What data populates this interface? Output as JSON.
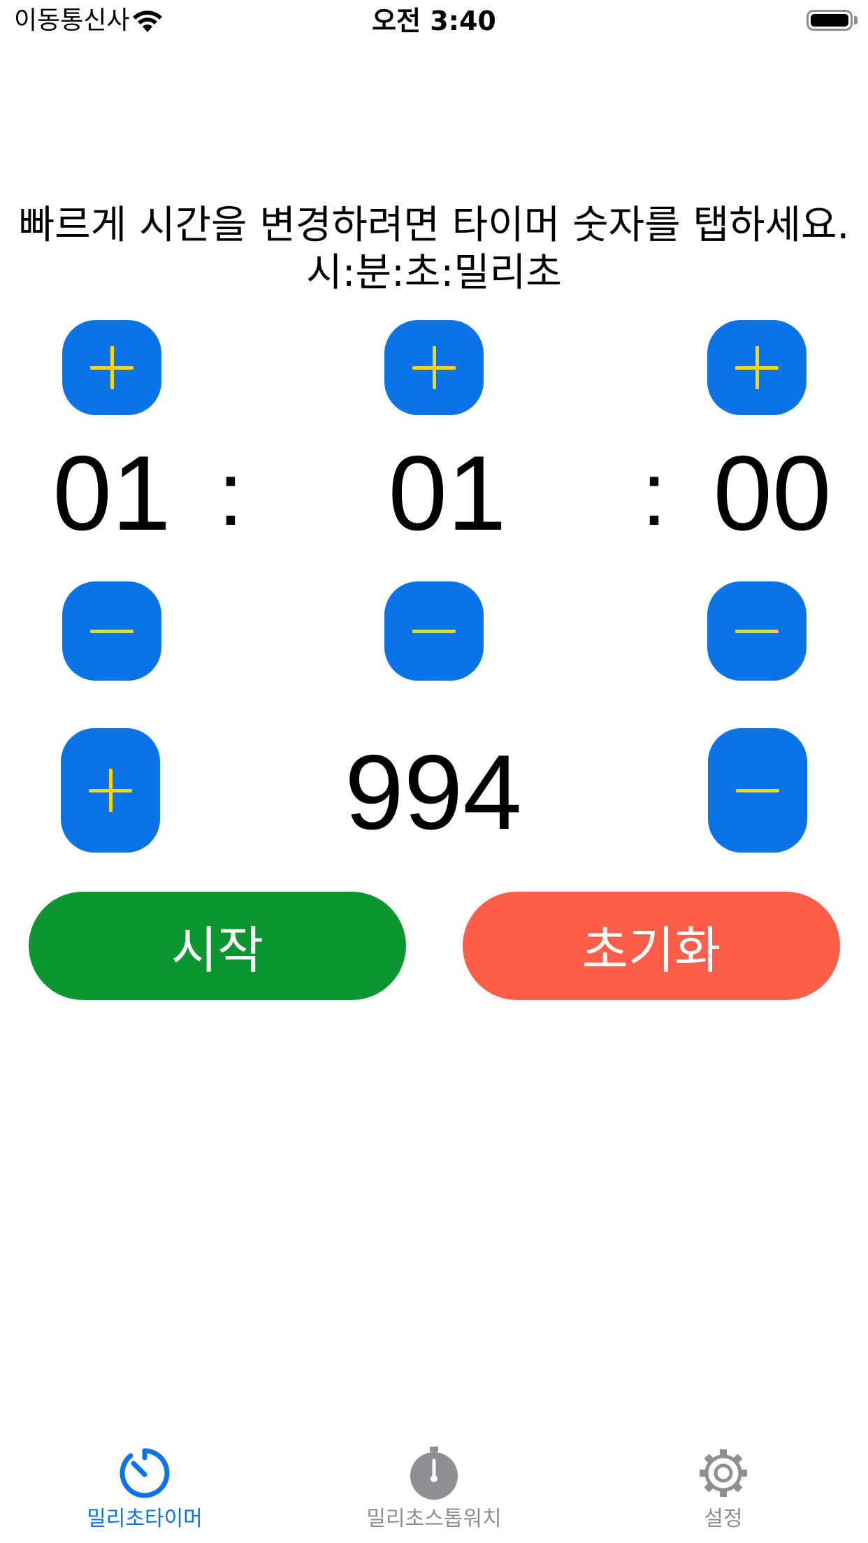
{
  "status_bar": {
    "carrier": "이동통신사",
    "time": "오전 3:40"
  },
  "instructions": {
    "line1": "빠르게 시간을 변경하려면 타이머 숫자를 탭하세요.",
    "line2": "시:분:초:밀리초"
  },
  "timer": {
    "hours": "01",
    "minutes": "01",
    "seconds": "00",
    "separator": ":",
    "milliseconds": "994"
  },
  "actions": {
    "start_label": "시작",
    "reset_label": "초기화"
  },
  "tab_bar": {
    "items": [
      {
        "label": "밀리초타이머",
        "icon": "timer-icon",
        "selected": true
      },
      {
        "label": "밀리초스톱워치",
        "icon": "stopwatch-icon",
        "selected": false
      },
      {
        "label": "설정",
        "icon": "gear-icon",
        "selected": false
      }
    ]
  },
  "colors": {
    "step_button": "#0a74e6",
    "step_glyph": "#ffd60a",
    "start": "#0c9632",
    "reset": "#fe5d49",
    "tab_active": "#0a74e6",
    "tab_inactive": "#8e8e93"
  }
}
